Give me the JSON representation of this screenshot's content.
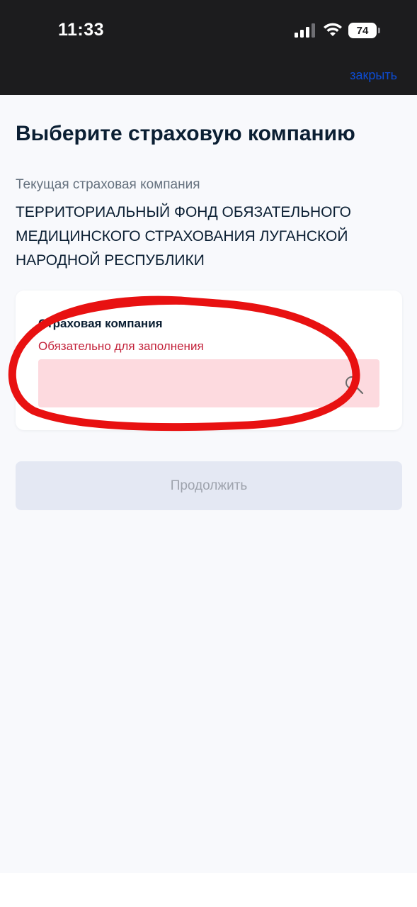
{
  "status_bar": {
    "time": "11:33",
    "battery": "74",
    "icons": [
      "signal-icon",
      "wifi-icon",
      "battery-icon"
    ]
  },
  "nav": {
    "close_label": "закрыть"
  },
  "page": {
    "title": "Выберите страховую компанию",
    "current_label": "Текущая страховая компания",
    "current_value": "ТЕРРИТОРИАЛЬНЫЙ ФОНД ОБЯЗАТЕЛЬНОГО МЕДИЦИНСКОГО СТРАХОВАНИЯ ЛУГАНСКОЙ НАРОДНОЙ РЕСПУБЛИКИ"
  },
  "insurer_field": {
    "label": "Страховая компания",
    "error": "Обязательно для заполнения",
    "value": "",
    "placeholder": "",
    "icon": "search-icon"
  },
  "actions": {
    "continue_label": "Продолжить"
  },
  "colors": {
    "link": "#0d4cd3",
    "error_text": "#c3223a",
    "error_field_bg": "#fddadf",
    "disabled_button_bg": "#e4e8f3",
    "annotation_stroke": "#e81111",
    "status_bar_bg": "#1c1c1e"
  }
}
